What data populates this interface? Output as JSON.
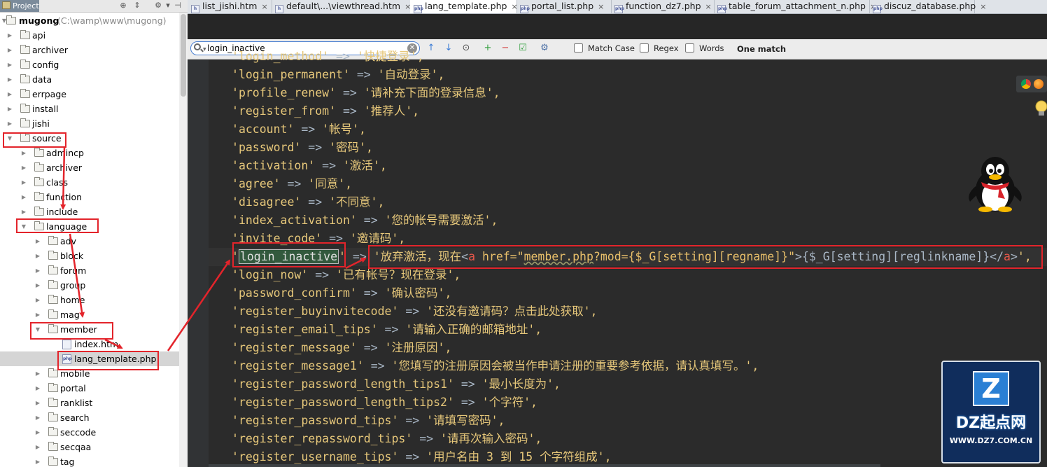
{
  "project_panel": {
    "tab_label": "Project",
    "root": {
      "name": "mugong",
      "path": "(C:\\wamp\\www\\mugong)"
    },
    "tree": [
      {
        "label": "api",
        "kind": "folder",
        "depth": 1,
        "expanded": false
      },
      {
        "label": "archiver",
        "kind": "folder",
        "depth": 1,
        "expanded": false
      },
      {
        "label": "config",
        "kind": "folder",
        "depth": 1,
        "expanded": false
      },
      {
        "label": "data",
        "kind": "folder",
        "depth": 1,
        "expanded": false
      },
      {
        "label": "errpage",
        "kind": "folder",
        "depth": 1,
        "expanded": false
      },
      {
        "label": "install",
        "kind": "folder",
        "depth": 1,
        "expanded": false
      },
      {
        "label": "jishi",
        "kind": "folder",
        "depth": 1,
        "expanded": false
      },
      {
        "label": "source",
        "kind": "folder",
        "depth": 1,
        "expanded": true
      },
      {
        "label": "admincp",
        "kind": "folder",
        "depth": 2,
        "expanded": false
      },
      {
        "label": "archiver",
        "kind": "folder",
        "depth": 2,
        "expanded": false
      },
      {
        "label": "class",
        "kind": "folder",
        "depth": 2,
        "expanded": false
      },
      {
        "label": "function",
        "kind": "folder",
        "depth": 2,
        "expanded": false
      },
      {
        "label": "include",
        "kind": "folder",
        "depth": 2,
        "expanded": false
      },
      {
        "label": "language",
        "kind": "folder",
        "depth": 2,
        "expanded": true
      },
      {
        "label": "adv",
        "kind": "folder",
        "depth": 3,
        "expanded": false
      },
      {
        "label": "block",
        "kind": "folder",
        "depth": 3,
        "expanded": false
      },
      {
        "label": "forum",
        "kind": "folder",
        "depth": 3,
        "expanded": false
      },
      {
        "label": "group",
        "kind": "folder",
        "depth": 3,
        "expanded": false
      },
      {
        "label": "home",
        "kind": "folder",
        "depth": 3,
        "expanded": false
      },
      {
        "label": "mag",
        "kind": "folder",
        "depth": 3,
        "expanded": false
      },
      {
        "label": "member",
        "kind": "folder",
        "depth": 3,
        "expanded": true
      },
      {
        "label": "index.htm",
        "kind": "htm",
        "depth": 4,
        "expanded": false
      },
      {
        "label": "lang_template.php",
        "kind": "php",
        "depth": 4,
        "expanded": false,
        "selected": true
      },
      {
        "label": "mobile",
        "kind": "folder",
        "depth": 3,
        "expanded": false
      },
      {
        "label": "portal",
        "kind": "folder",
        "depth": 3,
        "expanded": false
      },
      {
        "label": "ranklist",
        "kind": "folder",
        "depth": 3,
        "expanded": false
      },
      {
        "label": "search",
        "kind": "folder",
        "depth": 3,
        "expanded": false
      },
      {
        "label": "seccode",
        "kind": "folder",
        "depth": 3,
        "expanded": false
      },
      {
        "label": "secqaa",
        "kind": "folder",
        "depth": 3,
        "expanded": false
      },
      {
        "label": "tag",
        "kind": "folder",
        "depth": 3,
        "expanded": false
      }
    ]
  },
  "tabs": [
    {
      "label": "list_jishi.htm",
      "icon": "html-file-icon",
      "active": false
    },
    {
      "label": "default\\...\\viewthread.htm",
      "icon": "html-file-icon",
      "active": false
    },
    {
      "label": "lang_template.php",
      "icon": "php-file-icon",
      "active": true
    },
    {
      "label": "portal_list.php",
      "icon": "php-file-icon",
      "active": false
    },
    {
      "label": "function_dz7.php",
      "icon": "php-file-icon",
      "active": false
    },
    {
      "label": "table_forum_attachment_n.php",
      "icon": "php-file-icon",
      "active": false
    },
    {
      "label": "discuz_database.php",
      "icon": "php-file-icon",
      "active": false
    }
  ],
  "search": {
    "query": "login_inactive",
    "match_case_label": "Match Case",
    "regex_label": "Regex",
    "words_label": "Words",
    "match_info": "One match"
  },
  "code_lines": [
    {
      "key": "login_method",
      "val": "快捷登录"
    },
    {
      "key": "login_permanent",
      "val": "自动登录"
    },
    {
      "key": "profile_renew",
      "val": "请补充下面的登录信息"
    },
    {
      "key": "register_from",
      "val": "推荐人"
    },
    {
      "key": "account",
      "val": "帐号"
    },
    {
      "key": "password",
      "val": "密码"
    },
    {
      "key": "activation",
      "val": "激活"
    },
    {
      "key": "agree",
      "val": "同意"
    },
    {
      "key": "disagree",
      "val": "不同意"
    },
    {
      "key": "index_activation",
      "val": "您的帐号需要激活"
    },
    {
      "key": "invite_code",
      "val": "邀请码"
    },
    {
      "key": "login_inactive",
      "val": "放弃激活，现在<a href=\"member.php?mod={$_G[setting][regname]}\">{$_G[setting][reglinkname]}</a>"
    },
    {
      "key": "login_now",
      "val": "已有帐号？现在登录"
    },
    {
      "key": "password_confirm",
      "val": "确认密码"
    },
    {
      "key": "register_buyinvitecode",
      "val": "还没有邀请码？点击此处获取"
    },
    {
      "key": "register_email_tips",
      "val": "请输入正确的邮箱地址"
    },
    {
      "key": "register_message",
      "val": "注册原因"
    },
    {
      "key": "register_message1",
      "val": "您填写的注册原因会被当作申请注册的重要参考依据，请认真填写。"
    },
    {
      "key": "register_password_length_tips1",
      "val": "最小长度为"
    },
    {
      "key": "register_password_length_tips2",
      "val": "个字符"
    },
    {
      "key": "register_password_tips",
      "val": "请填写密码"
    },
    {
      "key": "register_repassword_tips",
      "val": "请再次输入密码"
    },
    {
      "key": "register_username_tips",
      "val": "用户名由 3 到 15 个字符组成"
    }
  ],
  "watermark": {
    "letter": "Z",
    "brand": "DZ起点网",
    "url": "WWW.DZ7.COM.CN"
  },
  "colors": {
    "annotation": "#e3242b",
    "string": "#e6c77a",
    "keyword": "#cc7832",
    "tag_red": "#e8574a"
  }
}
